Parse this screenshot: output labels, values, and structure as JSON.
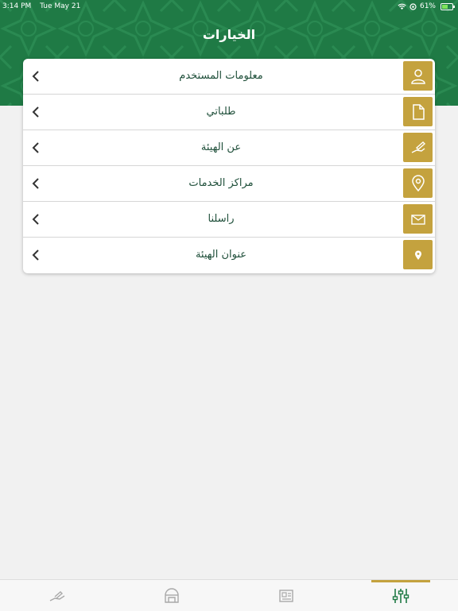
{
  "status_bar": {
    "time": "3:14 PM",
    "date": "Tue May 21",
    "battery": "61%",
    "battery_level": 0.61
  },
  "header": {
    "title": "الخيارات"
  },
  "menu": {
    "items": [
      {
        "label": "معلومات المستخدم",
        "icon": "user-icon"
      },
      {
        "label": "طلباتي",
        "icon": "document-icon"
      },
      {
        "label": "عن الهيئة",
        "icon": "hand-pen-icon"
      },
      {
        "label": "مراكز الخدمات",
        "icon": "location-outline-icon"
      },
      {
        "label": "راسلنا",
        "icon": "mail-icon"
      },
      {
        "label": "عنوان الهيئة",
        "icon": "location-pin-icon"
      }
    ]
  },
  "tabbar": {
    "tabs": [
      {
        "icon": "hand-service-icon"
      },
      {
        "icon": "building-icon"
      },
      {
        "icon": "news-icon"
      },
      {
        "icon": "settings-sliders-icon",
        "selected": true
      }
    ]
  },
  "colors": {
    "header_green": "#1f7a45",
    "accent_gold": "#c4a23e",
    "label_green": "#1f4f3a"
  }
}
